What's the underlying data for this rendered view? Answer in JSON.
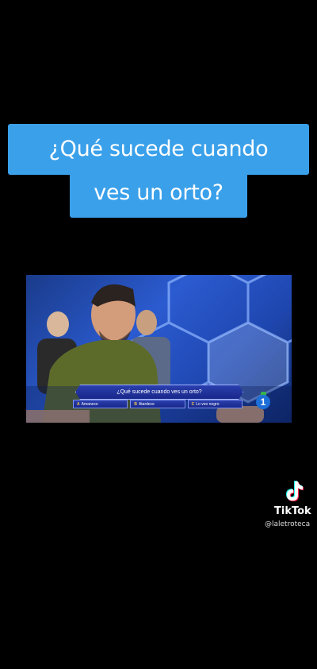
{
  "caption": {
    "line1": "¿Qué sucede cuando",
    "line2": "ves un orto?"
  },
  "video": {
    "question": "¿Qué sucede cuando ves un orto?",
    "answers": [
      {
        "key": "A",
        "text": "Amanece"
      },
      {
        "key": "B",
        "text": "Atardece"
      },
      {
        "key": "C",
        "text": "Lo veo negro"
      }
    ],
    "channel_badge": "1"
  },
  "watermark": {
    "brand": "TikTok",
    "username": "@laletroteca",
    "icon": "tiktok-note-icon"
  },
  "colors": {
    "caption_bg": "#3aa0ea",
    "background": "#000000"
  }
}
